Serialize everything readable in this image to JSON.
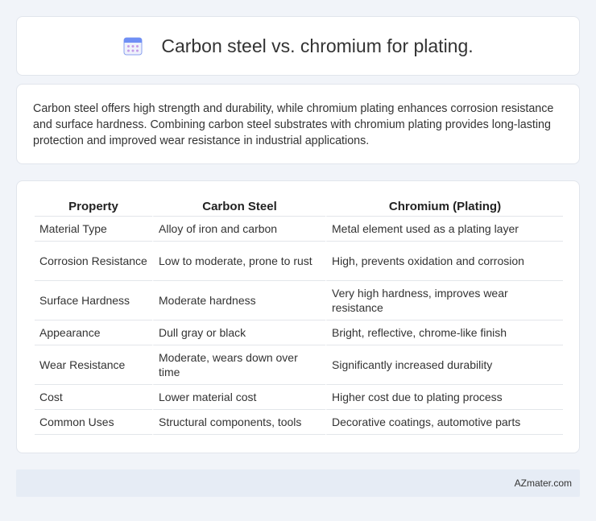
{
  "header": {
    "title": "Carbon steel vs. chromium for plating.",
    "icon": "calendar-icon"
  },
  "summary": {
    "text": "Carbon steel offers high strength and durability, while chromium plating enhances corrosion resistance and surface hardness. Combining carbon steel substrates with chromium plating provides long-lasting protection and improved wear resistance in industrial applications."
  },
  "table": {
    "headers": [
      "Property",
      "Carbon Steel",
      "Chromium (Plating)"
    ],
    "rows": [
      [
        "Material Type",
        "Alloy of iron and carbon",
        "Metal element used as a plating layer"
      ],
      [
        "Corrosion Resistance",
        "Low to moderate, prone to rust",
        "High, prevents oxidation and corrosion"
      ],
      [
        "Surface Hardness",
        "Moderate hardness",
        "Very high hardness, improves wear resistance"
      ],
      [
        "Appearance",
        "Dull gray or black",
        "Bright, reflective, chrome-like finish"
      ],
      [
        "Wear Resistance",
        "Moderate, wears down over time",
        "Significantly increased durability"
      ],
      [
        "Cost",
        "Lower material cost",
        "Higher cost due to plating process"
      ],
      [
        "Common Uses",
        "Structural components, tools",
        "Decorative coatings, automotive parts"
      ]
    ]
  },
  "footer": {
    "brand": "AZmater.com"
  },
  "colors": {
    "background": "#f1f4f9",
    "card": "#ffffff",
    "footer": "#e6ecf5",
    "icon_blue": "#6f8ff5",
    "icon_dots": "#c49be8"
  }
}
